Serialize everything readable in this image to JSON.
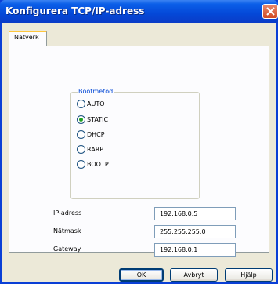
{
  "window": {
    "title": "Konfigurera TCP/IP-adress"
  },
  "tabs": [
    {
      "label": "Nätverk"
    }
  ],
  "bootmethod": {
    "legend": "Bootmetod",
    "options": [
      {
        "label": "AUTO",
        "selected": false
      },
      {
        "label": "STATIC",
        "selected": true
      },
      {
        "label": "DHCP",
        "selected": false
      },
      {
        "label": "RARP",
        "selected": false
      },
      {
        "label": "BOOTP",
        "selected": false
      }
    ]
  },
  "fields": [
    {
      "label": "IP-adress",
      "value": "192.168.0.5"
    },
    {
      "label": "Nätmask",
      "value": "255.255.255.0"
    },
    {
      "label": "Gateway",
      "value": "192.168.0.1"
    }
  ],
  "buttons": {
    "ok": "OK",
    "cancel": "Avbryt",
    "help": "Hjälp"
  },
  "colors": {
    "titlebar": "#0b5fe8",
    "dialog_bg": "#ece9d8",
    "selected_radio": "#21a121",
    "legend": "#0046d5"
  }
}
